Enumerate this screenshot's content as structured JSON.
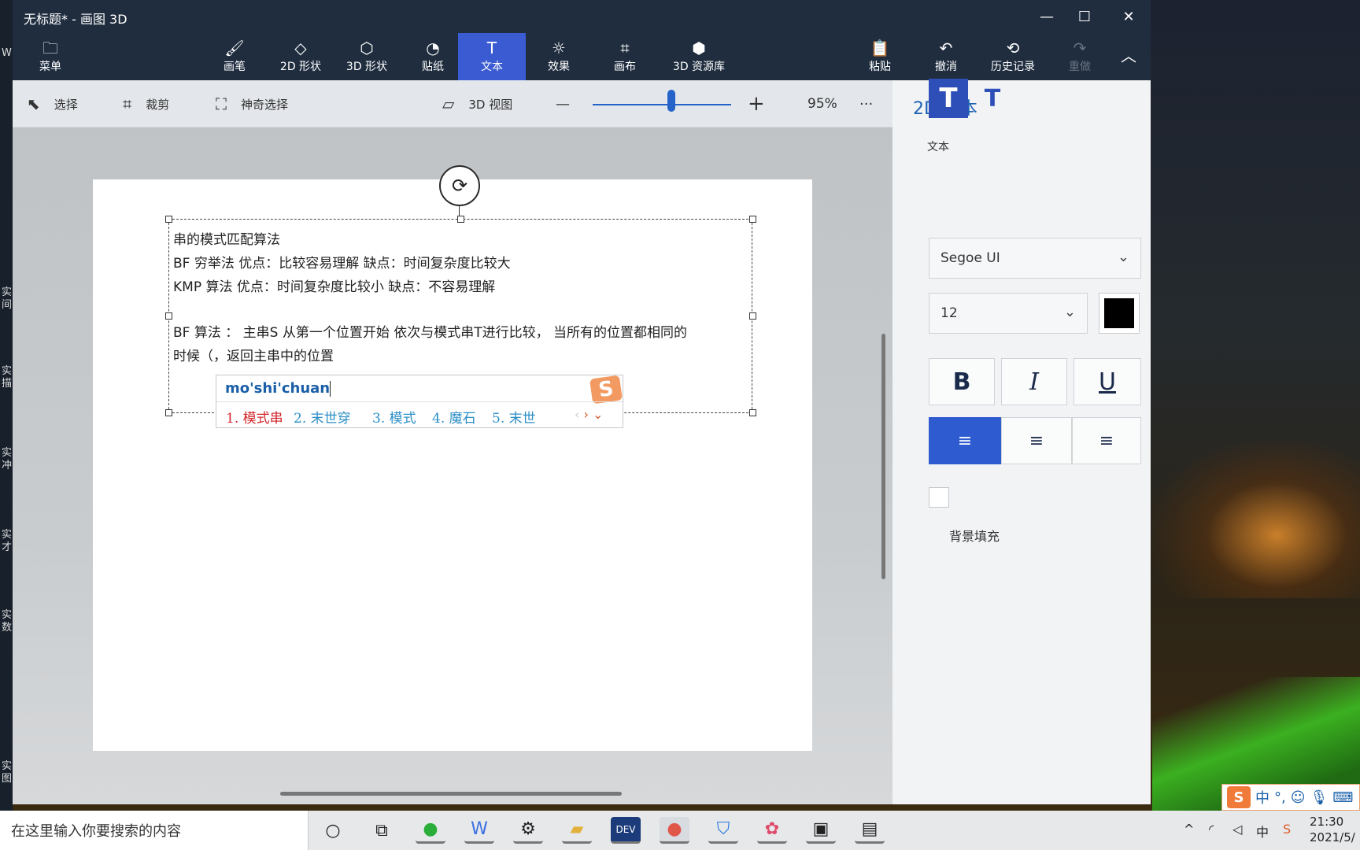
{
  "window": {
    "title": "无标题* - 画图 3D",
    "minimize": "—",
    "maximize": "☐",
    "close": "✕"
  },
  "ribbon": {
    "menu": {
      "label": "菜单",
      "icon": "folder-icon"
    },
    "tools": [
      {
        "label": "画笔",
        "icon": "brush-icon"
      },
      {
        "label": "2D 形状",
        "icon": "shapes-2d-icon"
      },
      {
        "label": "3D 形状",
        "icon": "cube-icon"
      },
      {
        "label": "贴纸",
        "icon": "sticker-icon"
      },
      {
        "label": "文本",
        "icon": "text-icon",
        "active": true
      },
      {
        "label": "效果",
        "icon": "sun-icon"
      },
      {
        "label": "画布",
        "icon": "canvas-icon"
      },
      {
        "label": "3D 资源库",
        "icon": "library-icon"
      }
    ],
    "paste": "粘贴",
    "undo": "撤消",
    "history": "历史记录",
    "redo": "重做"
  },
  "toolbar": {
    "select": "选择",
    "crop": "裁剪",
    "magic_select": "神奇选择",
    "view3d": "3D 视图",
    "zoom_minus": "—",
    "zoom_plus": "+",
    "zoom": "95%",
    "more": "···",
    "zoom_level": 0.48
  },
  "document": {
    "lines": [
      "串的模式匹配算法",
      "BF 穷举法   优点：比较容易理解        缺点：时间复杂度比较大",
      "KMP  算法  优点：时间复杂度比较小  缺点：不容易理解",
      "",
      "BF   算法 ： 主串S 从第一个位置开始 依次与模式串T进行比较， 当所有的位置都相同的",
      "时候（，返回主串中的位置"
    ]
  },
  "ime": {
    "pinyin": "mo'shi'chuan",
    "logo": "S",
    "candidates": [
      "1. 模式串",
      "2. 末世穿",
      "3. 模式",
      "4. 魔石",
      "5. 末世"
    ],
    "prev": "‹",
    "next": "›",
    "expand": "⌄"
  },
  "panel": {
    "title": "2D 文本",
    "text_label": "文本",
    "font": "Segoe UI",
    "size": "12",
    "color": "#000000",
    "bold": "B",
    "italic": "I",
    "underline": "U",
    "background_fill": "背景填充"
  },
  "taskbar": {
    "search_placeholder": "在这里输入你要搜索的内容",
    "time": "21:30",
    "date": "2021/5/",
    "ime_cn": "中",
    "ime_indicator": "中"
  },
  "imebar": {
    "lang": "中",
    "punct": "°,",
    "emoji": "☺",
    "mic": "🎙"
  },
  "desktop_labels": [
    "W",
    "实间",
    "实描",
    "实冲",
    "实才",
    "实数",
    "实图"
  ]
}
